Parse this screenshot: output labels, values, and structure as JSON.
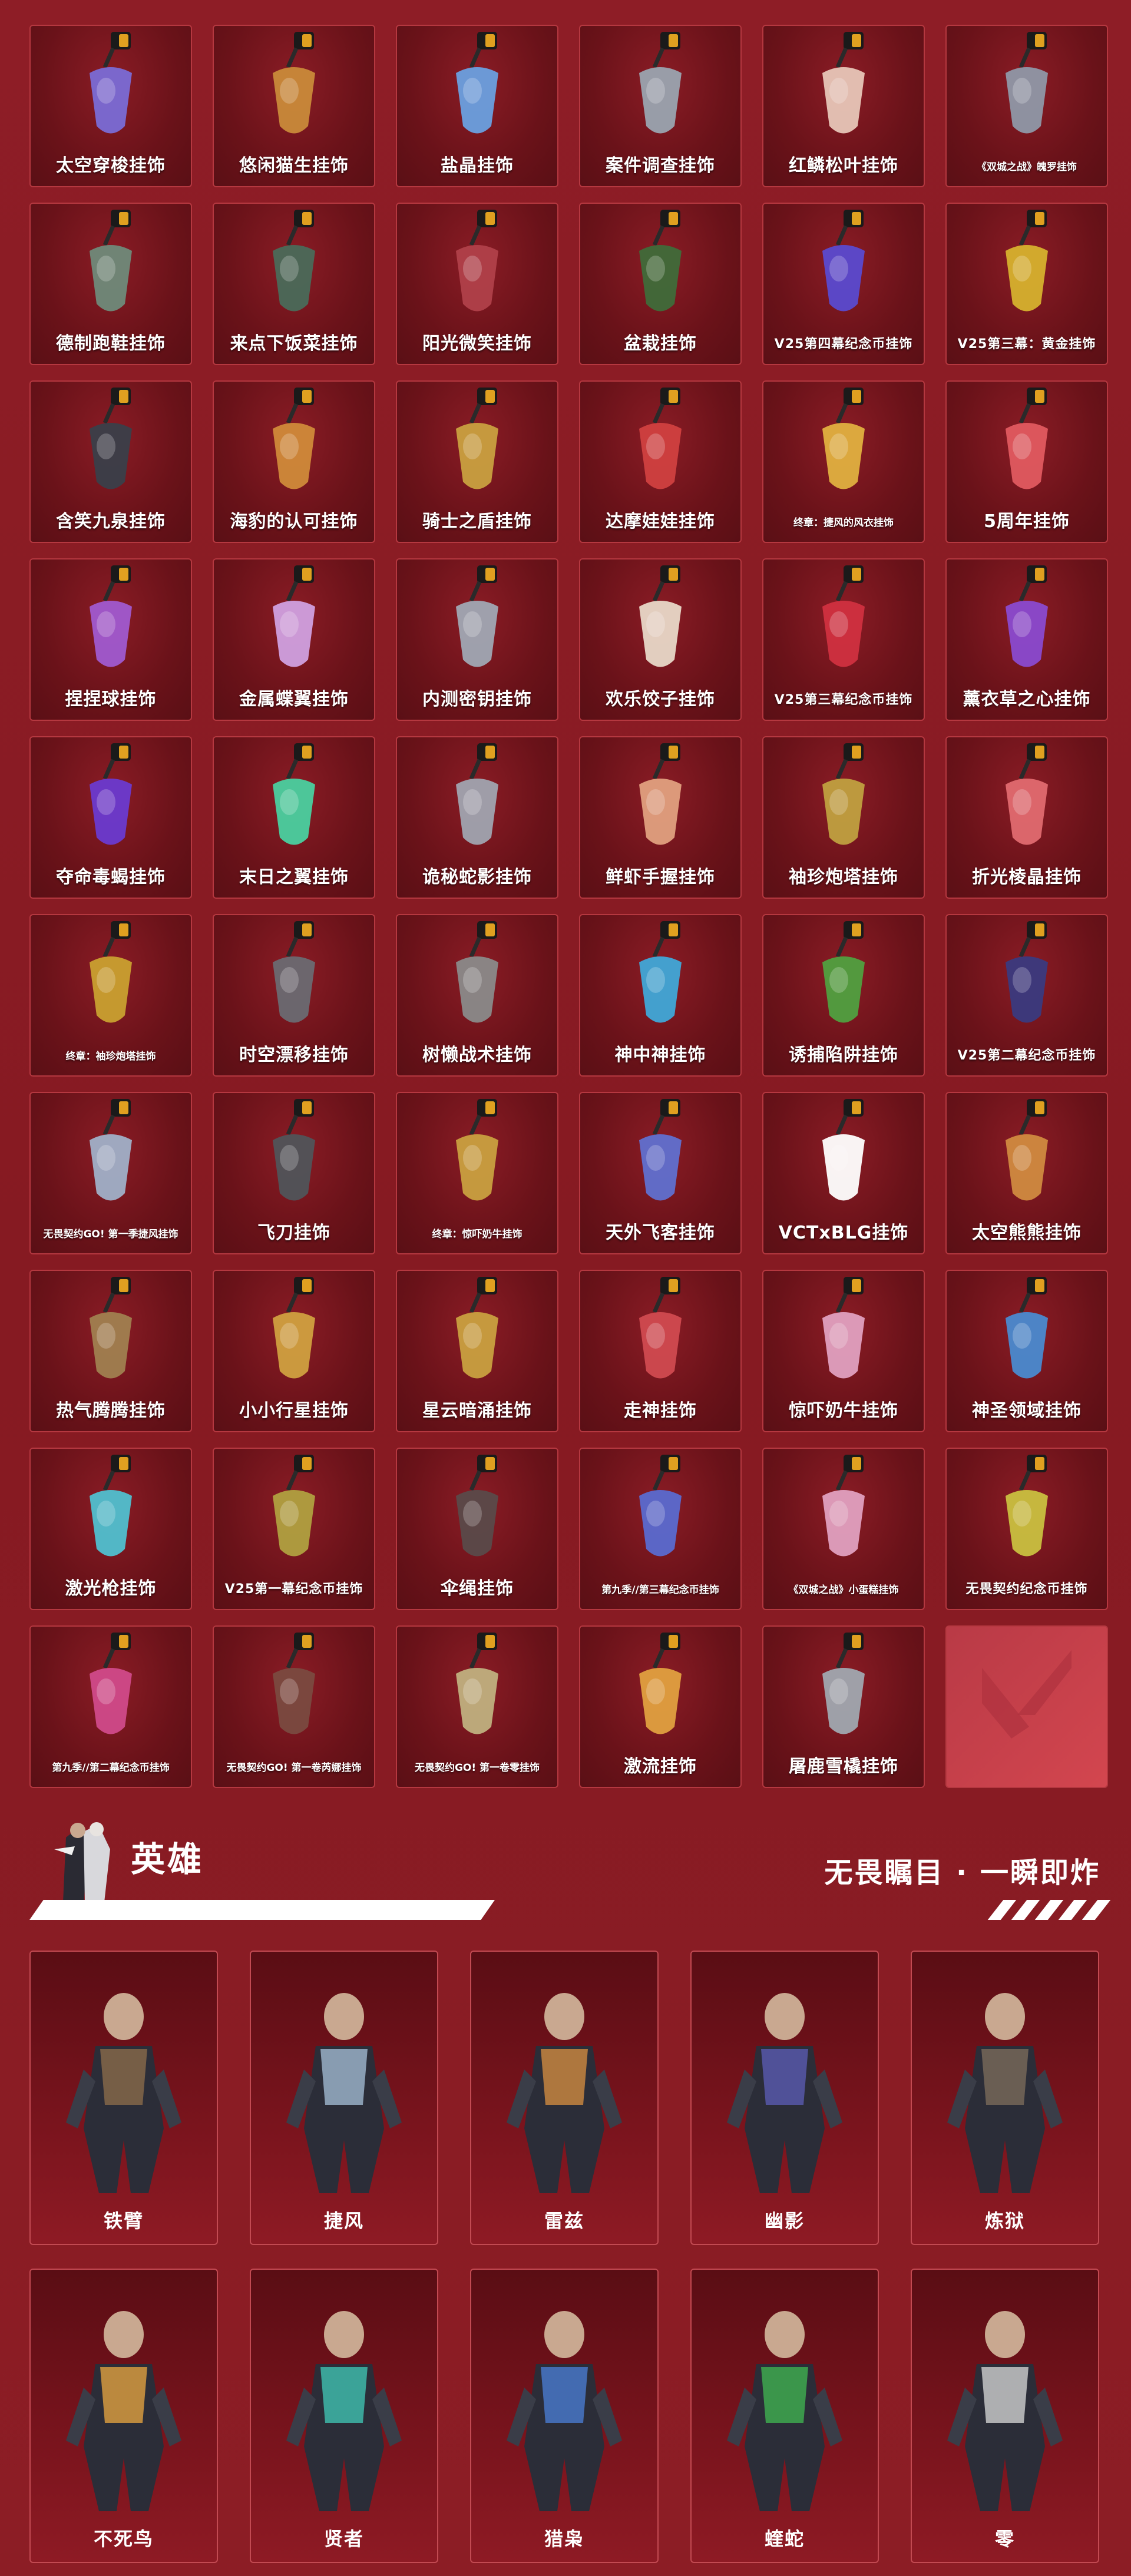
{
  "items": [
    {
      "label": "太空穿梭挂饰",
      "size": "",
      "icon": "spaceship-charm-icon",
      "color": "#7a6bd6"
    },
    {
      "label": "悠闲猫生挂饰",
      "size": "",
      "icon": "lantern-charm-icon",
      "color": "#c98a3a"
    },
    {
      "label": "盐晶挂饰",
      "size": "",
      "icon": "salt-crystal-charm-icon",
      "color": "#6aa0e0"
    },
    {
      "label": "案件调查挂饰",
      "size": "",
      "icon": "magnifier-charm-icon",
      "color": "#9aa4b0"
    },
    {
      "label": "红鳞松叶挂饰",
      "size": "",
      "icon": "koi-fish-charm-icon",
      "color": "#e7c6b8"
    },
    {
      "label": "《双城之战》魄罗挂饰",
      "size": "tiny",
      "icon": "poro-charm-icon",
      "color": "#8f98a8"
    },
    {
      "label": "德制跑鞋挂饰",
      "size": "",
      "icon": "sneaker-charm-icon",
      "color": "#6f8a7a"
    },
    {
      "label": "来点下饭菜挂饰",
      "size": "",
      "icon": "bag-charm-icon",
      "color": "#4a6a5a"
    },
    {
      "label": "阳光微笑挂饰",
      "size": "",
      "icon": "spike-ball-charm-icon",
      "color": "#b0404a"
    },
    {
      "label": "盆栽挂饰",
      "size": "",
      "icon": "bonsai-charm-icon",
      "color": "#3f6b3a"
    },
    {
      "label": "V25第四幕纪念币挂饰",
      "size": "small",
      "icon": "v25-coin-iv-charm-icon",
      "color": "#5a4ad0"
    },
    {
      "label": "V25第三幕：黄金挂饰",
      "size": "small",
      "icon": "v25-gold-charm-icon",
      "color": "#d6b12e"
    },
    {
      "label": "含笑九泉挂饰",
      "size": "",
      "icon": "dagger-charm-icon",
      "color": "#3a3f4a"
    },
    {
      "label": "海豹的认可挂饰",
      "size": "",
      "icon": "seal-charm-icon",
      "color": "#d08a3a"
    },
    {
      "label": "骑士之盾挂饰",
      "size": "",
      "icon": "shield-charm-icon",
      "color": "#c9a040"
    },
    {
      "label": "达摩娃娃挂饰",
      "size": "",
      "icon": "daruma-charm-icon",
      "color": "#d04040"
    },
    {
      "label": "终章：捷风的风衣挂饰",
      "size": "tiny",
      "icon": "jacket-charm-icon",
      "color": "#e0b040"
    },
    {
      "label": "5周年挂饰",
      "size": "",
      "icon": "five-year-charm-icon",
      "color": "#e05a60"
    },
    {
      "label": "捏捏球挂饰",
      "size": "",
      "icon": "squish-ball-charm-icon",
      "color": "#a05ad0"
    },
    {
      "label": "金属蝶翼挂饰",
      "size": "",
      "icon": "butterfly-charm-icon",
      "color": "#d0a0e0"
    },
    {
      "label": "内测密钥挂饰",
      "size": "",
      "icon": "key-charm-icon",
      "color": "#a0a8b4"
    },
    {
      "label": "欢乐饺子挂饰",
      "size": "",
      "icon": "dumpling-charm-icon",
      "color": "#e8d8c8"
    },
    {
      "label": "V25第三幕纪念币挂饰",
      "size": "small",
      "icon": "v25-coin-iii-charm-icon",
      "color": "#d03040"
    },
    {
      "label": "薰衣草之心挂饰",
      "size": "",
      "icon": "heart-charm-icon",
      "color": "#8a4ad0"
    },
    {
      "label": "夺命毒蝎挂饰",
      "size": "",
      "icon": "scorpion-charm-icon",
      "color": "#6a3ad0"
    },
    {
      "label": "末日之翼挂饰",
      "size": "",
      "icon": "wing-emblem-charm-icon",
      "color": "#4ad0a0"
    },
    {
      "label": "诡秘蛇影挂饰",
      "size": "",
      "icon": "snake-charm-icon",
      "color": "#a0a4b0"
    },
    {
      "label": "鲜虾手握挂饰",
      "size": "",
      "icon": "shrimp-roll-charm-icon",
      "color": "#e0a080"
    },
    {
      "label": "袖珍炮塔挂饰",
      "size": "",
      "icon": "turret-charm-icon",
      "color": "#c0a040"
    },
    {
      "label": "折光棱晶挂饰",
      "size": "",
      "icon": "prism-charm-icon",
      "color": "#e06a70"
    },
    {
      "label": "终章：袖珍炮塔挂饰",
      "size": "tiny",
      "icon": "gold-turret-charm-icon",
      "color": "#c9a030"
    },
    {
      "label": "时空漂移挂饰",
      "size": "",
      "icon": "boot-charm-icon",
      "color": "#6a6a72"
    },
    {
      "label": "树懒战术挂饰",
      "size": "",
      "icon": "sloth-charm-icon",
      "color": "#8a8a8a"
    },
    {
      "label": "神中神挂饰",
      "size": "",
      "icon": "blade-charm-icon",
      "color": "#40a8d8"
    },
    {
      "label": "诱捕陷阱挂饰",
      "size": "",
      "icon": "trap-plant-charm-icon",
      "color": "#50a040"
    },
    {
      "label": "V25第二幕纪念币挂饰",
      "size": "small",
      "icon": "v25-coin-ii-charm-icon",
      "color": "#3a3a80"
    },
    {
      "label": "无畏契约GO! 第一季捷风挂饰",
      "size": "tiny",
      "icon": "jett-chibi-charm-icon",
      "color": "#a0b0c8"
    },
    {
      "label": "飞刀挂饰",
      "size": "",
      "icon": "kunai-charm-icon",
      "color": "#50545a"
    },
    {
      "label": "终章：惊吓奶牛挂饰",
      "size": "tiny",
      "icon": "cow-charm-icon",
      "color": "#c9a040"
    },
    {
      "label": "天外飞客挂饰",
      "size": "",
      "icon": "ufo-charm-icon",
      "color": "#6070d0"
    },
    {
      "label": "VCTxBLG挂饰",
      "size": "",
      "icon": "blg-logo-charm-icon",
      "color": "#ffffff"
    },
    {
      "label": "太空熊熊挂饰",
      "size": "",
      "icon": "space-bear-charm-icon",
      "color": "#d08a40"
    },
    {
      "label": "热气腾腾挂饰",
      "size": "",
      "icon": "bowl-charm-icon",
      "color": "#a08050"
    },
    {
      "label": "小小行星挂饰",
      "size": "",
      "icon": "planet-charm-icon",
      "color": "#d0a040"
    },
    {
      "label": "星云暗涌挂饰",
      "size": "",
      "icon": "nebula-charm-icon",
      "color": "#c9a040"
    },
    {
      "label": "走神挂饰",
      "size": "",
      "icon": "spirit-charm-icon",
      "color": "#d04a50"
    },
    {
      "label": "惊吓奶牛挂饰",
      "size": "",
      "icon": "pink-cow-charm-icon",
      "color": "#e0a0c0"
    },
    {
      "label": "神圣领域挂饰",
      "size": "",
      "icon": "barrier-charm-icon",
      "color": "#4a8ad0"
    },
    {
      "label": "激光枪挂饰",
      "size": "",
      "icon": "laser-gun-charm-icon",
      "color": "#50c0d0"
    },
    {
      "label": "V25第一幕纪念币挂饰",
      "size": "small",
      "icon": "v25-coin-i-charm-icon",
      "color": "#b0a040"
    },
    {
      "label": "伞绳挂饰",
      "size": "",
      "icon": "paracord-charm-icon",
      "color": "#5a4a4a"
    },
    {
      "label": "第九季//第三幕纪念币挂饰",
      "size": "tiny",
      "icon": "ep9-coin-charm-icon",
      "color": "#5a6ad0"
    },
    {
      "label": "《双城之战》小蛋糕挂饰",
      "size": "tiny",
      "icon": "cupcake-charm-icon",
      "color": "#e0a0c0"
    },
    {
      "label": "无畏契约纪念币挂饰",
      "size": "small",
      "icon": "valorant-coin-charm-icon",
      "color": "#c9c040"
    },
    {
      "label": "第九季//第二幕纪念币挂饰",
      "size": "tiny",
      "icon": "ep9-coin-ii-charm-icon",
      "color": "#d04a8a"
    },
    {
      "label": "无畏契约GO! 第一卷芮娜挂饰",
      "size": "tiny",
      "icon": "reyna-chibi-charm-icon",
      "color": "#7a4a40"
    },
    {
      "label": "无畏契约GO! 第一卷零挂饰",
      "size": "tiny",
      "icon": "cypher-chibi-charm-icon",
      "color": "#c0b080"
    },
    {
      "label": "激流挂饰",
      "size": "",
      "icon": "surfboard-charm-icon",
      "color": "#e0a040"
    },
    {
      "label": "屠鹿雪橇挂饰",
      "size": "",
      "icon": "sled-charm-icon",
      "color": "#a0a8b0"
    }
  ],
  "logo_card": {
    "icon": "valorant-logo-icon"
  },
  "hero_section": {
    "title": "英雄",
    "slogan": "无畏瞩目 · 一瞬即炸"
  },
  "agents": [
    {
      "name": "铁臂",
      "icon": "breach-portrait-icon",
      "color": "#8a6a4a"
    },
    {
      "name": "捷风",
      "icon": "jett-portrait-icon",
      "color": "#a0b8d0"
    },
    {
      "name": "雷兹",
      "icon": "raze-portrait-icon",
      "color": "#d08a40"
    },
    {
      "name": "幽影",
      "icon": "omen-portrait-icon",
      "color": "#5a5ab0"
    },
    {
      "name": "炼狱",
      "icon": "brimstone-portrait-icon",
      "color": "#7a6a5a"
    },
    {
      "name": "不死鸟",
      "icon": "phoenix-portrait-icon",
      "color": "#e0a040"
    },
    {
      "name": "贤者",
      "icon": "sage-portrait-icon",
      "color": "#40c0b0"
    },
    {
      "name": "猎枭",
      "icon": "sova-portrait-icon",
      "color": "#4a7ad0"
    },
    {
      "name": "蝰蛇",
      "icon": "viper-portrait-icon",
      "color": "#40b050"
    },
    {
      "name": "零",
      "icon": "cypher-portrait-icon",
      "color": "#d0d0d0"
    }
  ]
}
